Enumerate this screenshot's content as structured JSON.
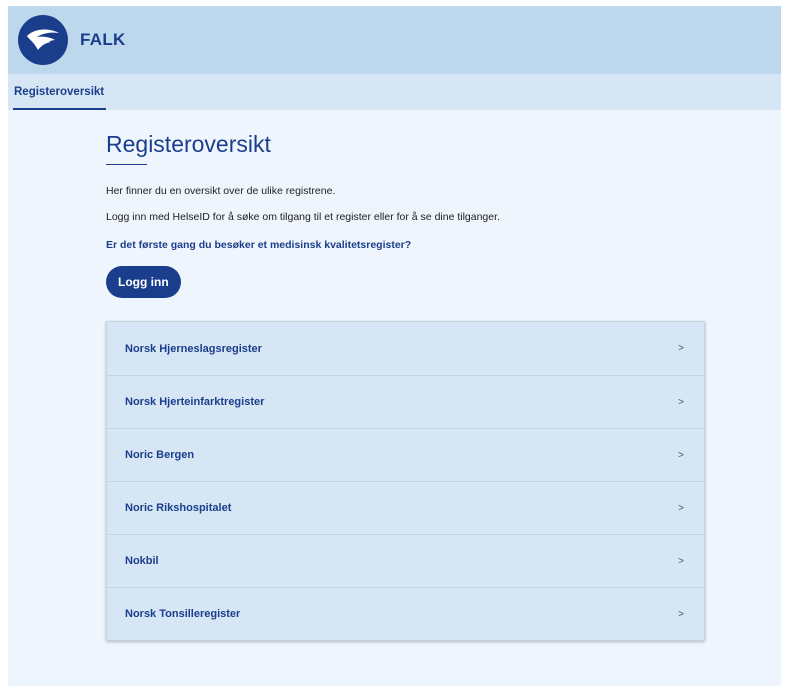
{
  "header": {
    "brand": "FALK",
    "logo_icon": "bird-logo-icon"
  },
  "nav": {
    "tabs": [
      {
        "label": "Registeroversikt",
        "active": true
      }
    ]
  },
  "main": {
    "title": "Registeroversikt",
    "intro": "Her finner du en oversikt over de ulike registrene.",
    "login_hint": "Logg inn med HelseID for å søke om tilgang til et register eller for å se dine tilganger.",
    "first_time_link": "Er det første gang du besøker et medisinsk kvalitetsregister?",
    "login_button": "Logg inn"
  },
  "registers": [
    {
      "name": "Norsk Hjerneslagsregister",
      "chevron": ">"
    },
    {
      "name": "Norsk Hjerteinfarktregister",
      "chevron": ">"
    },
    {
      "name": "Noric Bergen",
      "chevron": ">"
    },
    {
      "name": "Noric Rikshospitalet",
      "chevron": ">"
    },
    {
      "name": "Nokbil",
      "chevron": ">"
    },
    {
      "name": "Norsk Tonsilleregister",
      "chevron": ">"
    }
  ],
  "colors": {
    "primary": "#1b3e8c",
    "header_bg": "#bdd7ec",
    "nav_bg": "#d6e6f4",
    "page_bg": "#eff5fc",
    "list_bg": "#d6e6f4"
  }
}
